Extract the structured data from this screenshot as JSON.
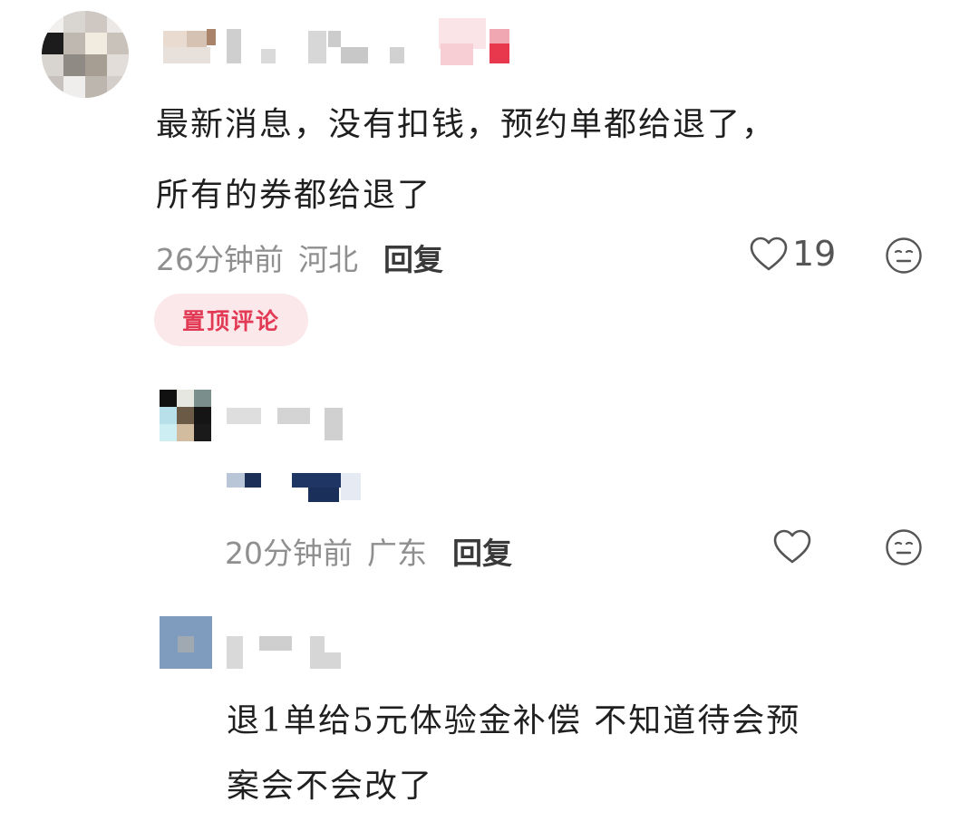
{
  "comments": [
    {
      "text_line1": "最新消息，没有扣钱，预约单都给退了，",
      "text_line2": "所有的券都给退了",
      "time": "26分钟前",
      "location": "河北",
      "reply_label": "回复",
      "like_count": "19",
      "badge": "置顶评论"
    },
    {
      "time": "20分钟前",
      "location": "广东",
      "reply_label": "回复"
    },
    {
      "text_line1": "退1单给5元体验金补偿 不知道待会预",
      "text_line2": "案会不会改了"
    }
  ],
  "icons": {
    "like": "heart-outline-icon",
    "react": "neutral-face-icon"
  },
  "colors": {
    "badge_bg": "#fbe8ea",
    "badge_text": "#e23a55",
    "meta_text": "#8f8f8f",
    "body_text": "#1f1f1f"
  }
}
